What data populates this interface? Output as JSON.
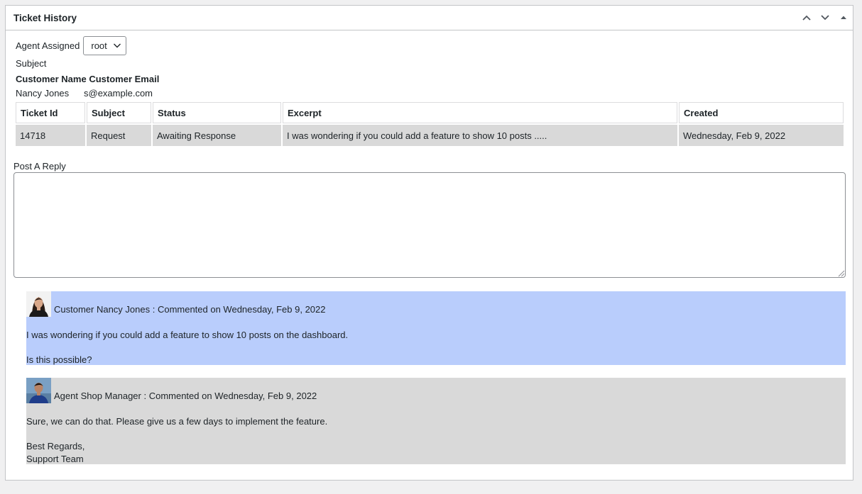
{
  "panel": {
    "title": "Ticket History",
    "controls": [
      "chevron-up-icon",
      "chevron-down-icon",
      "triangle-up-icon"
    ]
  },
  "agent": {
    "label": "Agent Assigned",
    "selected": "root"
  },
  "subject_label": "Subject",
  "customer": {
    "name_header": "Customer Name",
    "email_header": "Customer Email",
    "name": "Nancy Jones",
    "email": "s@example.com"
  },
  "table": {
    "headers": [
      "Ticket Id",
      "Subject",
      "Status",
      "Excerpt",
      "Created"
    ],
    "rows": [
      [
        "14718",
        "Request",
        "Awaiting Response",
        "I was wondering if you could add a feature to show 10 posts .....",
        "Wednesday, Feb 9, 2022"
      ]
    ]
  },
  "reply": {
    "label": "Post A Reply",
    "value": ""
  },
  "comments": [
    {
      "meta": "Customer Nancy Jones : Commented on Wednesday, Feb 9, 2022",
      "line1": "I was wondering if you could add a feature to show 10 posts on the dashboard.",
      "line2": "Is this possible?",
      "color": "#b9cdfc"
    },
    {
      "meta": "Agent Shop Manager : Commented on Wednesday, Feb 9, 2022",
      "line1": "Sure, we can do that. Please give us a few days to implement the feature.",
      "line2": "Best Regards,",
      "line3": "Support Team",
      "color": "#d9d9d9"
    }
  ]
}
